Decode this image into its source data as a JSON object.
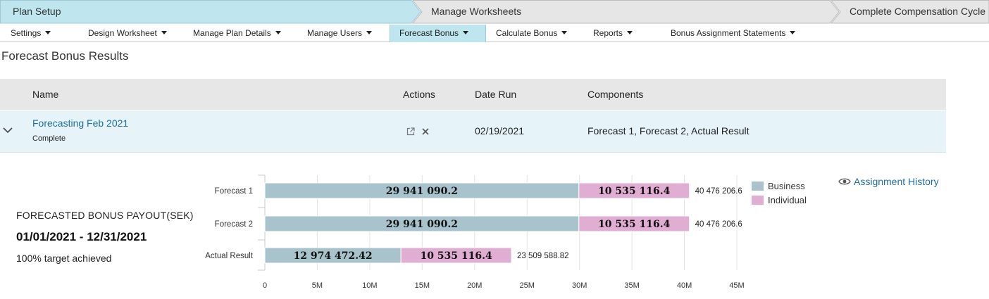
{
  "process": {
    "steps": [
      {
        "label": "Plan Setup",
        "active": true
      },
      {
        "label": "Manage Worksheets",
        "active": false
      },
      {
        "label": "Complete Compensation Cycle",
        "active": false
      }
    ]
  },
  "menu": {
    "items": [
      {
        "label": "Settings"
      },
      {
        "label": "Design Worksheet"
      },
      {
        "label": "Manage Plan Details"
      },
      {
        "label": "Manage Users"
      },
      {
        "label": "Forecast Bonus",
        "active": true
      },
      {
        "label": "Calculate Bonus"
      },
      {
        "label": "Reports"
      },
      {
        "label": "Bonus Assignment Statements"
      }
    ]
  },
  "page": {
    "title": "Forecast Bonus Results"
  },
  "table": {
    "headers": {
      "name": "Name",
      "actions": "Actions",
      "date": "Date Run",
      "components": "Components"
    },
    "rows": [
      {
        "name": "Forecasting Feb 2021",
        "status": "Complete",
        "date": "02/19/2021",
        "components": "Forecast 1, Forecast 2, Actual Result"
      }
    ]
  },
  "summary": {
    "title": "FORECASTED BONUS PAYOUT(SEK)",
    "range": "01/01/2021 - 12/31/2021",
    "target": "100% target achieved"
  },
  "assignment_history": {
    "label": "Assignment History",
    "icon": "eye-icon"
  },
  "colors": {
    "business": "#a9c3cc",
    "individual": "#e1aed3",
    "link": "#1f6fa3",
    "active_step": "#bfe6ef"
  },
  "chart_data": {
    "type": "bar",
    "orientation": "horizontal",
    "stacked": true,
    "categories": [
      "Forecast 1",
      "Forecast 2",
      "Actual Result"
    ],
    "series": [
      {
        "name": "Business",
        "values": [
          29941090.2,
          29941090.2,
          12974472.42
        ],
        "labels": [
          "29 941 090.2",
          "29 941 090.2",
          "12 974 472.42"
        ]
      },
      {
        "name": "Individual",
        "values": [
          10535116.4,
          10535116.4,
          10535116.4
        ],
        "labels": [
          "10 535 116.4",
          "10 535 116.4",
          "10 535 116.4"
        ]
      }
    ],
    "totals": [
      "40 476 206.6",
      "40 476 206.6",
      "23 509 588.82"
    ],
    "xlim": [
      0,
      45000000
    ],
    "ticks": [
      {
        "value": 0,
        "label": "0"
      },
      {
        "value": 5000000,
        "label": "5M"
      },
      {
        "value": 10000000,
        "label": "10M"
      },
      {
        "value": 15000000,
        "label": "15M"
      },
      {
        "value": 20000000,
        "label": "20M"
      },
      {
        "value": 25000000,
        "label": "25M"
      },
      {
        "value": 30000000,
        "label": "30M"
      },
      {
        "value": 35000000,
        "label": "35M"
      },
      {
        "value": 40000000,
        "label": "40M"
      },
      {
        "value": 45000000,
        "label": "45M"
      }
    ],
    "grid": true,
    "legend": "top-right"
  }
}
